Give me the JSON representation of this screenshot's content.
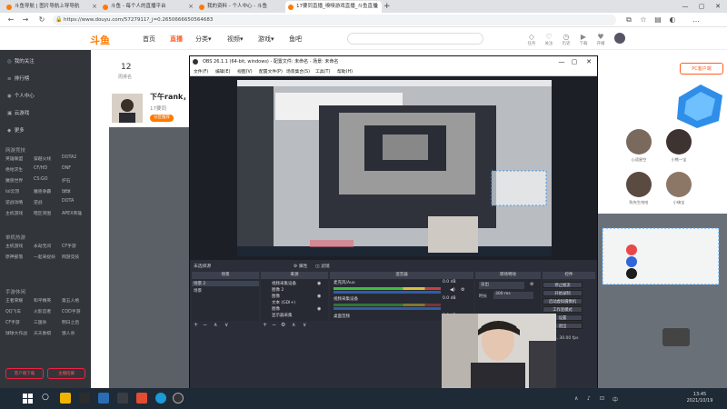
{
  "browser": {
    "tabs": [
      {
        "label": "斗鱼导航 | 图片导航上导导航"
      },
      {
        "label": "斗鱼 - 每个人的直播平台"
      },
      {
        "label": "我的资料 - 个人中心 - 斗鱼"
      },
      {
        "label": "17要同直播_嗅嗅游戏直播_斗鱼直播"
      }
    ],
    "new_tab_symbol": "+",
    "url": "https://www.douyu.com/5727911?_j=0.2650666650564683",
    "window_controls": [
      "—",
      "▢",
      "✕"
    ]
  },
  "site": {
    "logo": "斗鱼",
    "nav": [
      {
        "label": "首页",
        "active": false
      },
      {
        "label": "直播",
        "active": true
      },
      {
        "label": "分类▾",
        "active": false
      },
      {
        "label": "视频▾",
        "active": false
      },
      {
        "label": "游戏▾",
        "active": false
      },
      {
        "label": "鱼吧",
        "active": false
      }
    ],
    "header_icons": [
      {
        "glyph": "◇",
        "label": "任务"
      },
      {
        "glyph": "♡",
        "label": "关注"
      },
      {
        "glyph": "◷",
        "label": "历史"
      },
      {
        "glyph": "▶",
        "label": "下载"
      },
      {
        "glyph": "♥",
        "label": "开播"
      }
    ]
  },
  "sidebar": {
    "top_items": [
      {
        "icon": "◎",
        "label": "我的关注"
      },
      {
        "icon": "≡",
        "label": "排行榜"
      },
      {
        "icon": "◉",
        "label": "个人中心"
      },
      {
        "icon": "▣",
        "label": "云游戏"
      },
      {
        "icon": "◆",
        "label": "更多"
      }
    ],
    "sections": [
      {
        "title": "网游竞技",
        "items": [
          "英雄联盟",
          "穿越火线",
          "DOTA2",
          "绝地求生",
          "CF/HD",
          "DNF",
          "魔兽世界",
          "CS:GO",
          "炉石",
          "lol云顶",
          "魔兽争霸",
          "球球",
          "逆战攻略",
          "逆战",
          "DOTA",
          "主机游戏",
          "暗区突围",
          "APEX英雄"
        ]
      },
      {
        "title": "单机热游",
        "items": [
          "主机游戏",
          "永劫无间",
          "CF手游",
          "原神部落",
          "一起来捉妖",
          "网游竞技"
        ]
      },
      {
        "title": "手游休闲",
        "items": [
          "王者荣耀",
          "和平精英",
          "第五人格",
          "QQ飞车",
          "火影忍者",
          "COD手游",
          "CF手游",
          "三国杀",
          "明日之后",
          "球球大作战",
          "天天象棋",
          "狼人杀"
        ]
      }
    ],
    "bottom_buttons": [
      "客户端下载",
      "主播招募"
    ]
  },
  "room": {
    "rank_value": "12",
    "rank_label": "周排名",
    "title": "下午rank，唯...",
    "streamer": "17要同",
    "tag": "分区推荐",
    "pc_button": "PC客户端",
    "fans": [
      {
        "name": "心语星空"
      },
      {
        "name": "小熊一宝"
      },
      {
        "name": "陈先生哈哈"
      },
      {
        "name": "小嗨宝"
      },
      {
        "name": "小嗨宝"
      },
      {
        "name": "胡子大人"
      }
    ]
  },
  "obs": {
    "title": "OBS 26.1.1 (64-bit, windows) - 配置文件: 未命名 - 场景: 未命名",
    "menu": [
      "文件(F)",
      "编辑(E)",
      "视图(V)",
      "配置文件(P)",
      "场景集合(S)",
      "工具(T)",
      "帮助(H)"
    ],
    "scene_label": "未选择源",
    "scene_buttons": [
      "属性",
      "滤镜"
    ],
    "docks": {
      "scenes": {
        "header": "场景",
        "items": [
          "场景 2",
          "场景"
        ]
      },
      "sources": {
        "header": "来源",
        "items": [
          "视频采集设备",
          "图像 2",
          "图像",
          "文本 (GDI+)",
          "图像",
          "显示器采集"
        ]
      },
      "mixer": {
        "header": "混音器",
        "items": [
          {
            "name": "麦克风/Aux",
            "db": "0.0 dB"
          },
          {
            "name": "视频采集设备",
            "db": "0.0 dB"
          },
          {
            "name": "桌面音频",
            "db": "0.0 dB"
          }
        ]
      },
      "transitions": {
        "header": "转场特效",
        "mode": "淡出",
        "duration_label": "时长",
        "duration": "300 ms"
      },
      "controls": {
        "header": "控件",
        "buttons": [
          "停止推流",
          "开始录制",
          "启动虚拟摄像机",
          "工作室模式",
          "设置",
          "退出"
        ]
      }
    },
    "status": "CPU: 9.4%, 30.00 fps"
  },
  "taskbar": {
    "time": "13:45",
    "date": "2021/10/19",
    "tray_icons": [
      "∧",
      "♪",
      "⊡",
      "中"
    ]
  },
  "colors": {
    "accent": "#ff5d23",
    "sidebar_bg": "#32363b",
    "obs_bg": "#2b2e38",
    "taskbar_bg": "#1f2a37"
  }
}
